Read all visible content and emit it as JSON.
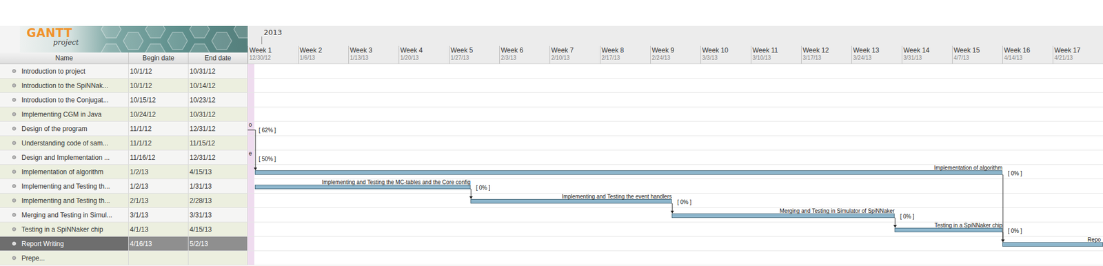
{
  "logo": {
    "title": "GANTT",
    "subtitle": "project"
  },
  "table": {
    "columns": [
      "Name",
      "Begin date",
      "End date"
    ]
  },
  "timeline": {
    "year": "2013",
    "weeks": [
      {
        "label": "Week 1",
        "date": "12/30/12"
      },
      {
        "label": "Week 2",
        "date": "1/6/13"
      },
      {
        "label": "Week 3",
        "date": "1/13/13"
      },
      {
        "label": "Week 4",
        "date": "1/20/13"
      },
      {
        "label": "Week 5",
        "date": "1/27/13"
      },
      {
        "label": "Week 6",
        "date": "2/3/13"
      },
      {
        "label": "Week 7",
        "date": "2/10/13"
      },
      {
        "label": "Week 8",
        "date": "2/17/13"
      },
      {
        "label": "Week 9",
        "date": "2/24/13"
      },
      {
        "label": "Week 10",
        "date": "3/3/13"
      },
      {
        "label": "Week 11",
        "date": "3/10/13"
      },
      {
        "label": "Week 12",
        "date": "3/17/13"
      },
      {
        "label": "Week 13",
        "date": "3/24/13"
      },
      {
        "label": "Week 14",
        "date": "3/31/13"
      },
      {
        "label": "Week 15",
        "date": "4/7/13"
      },
      {
        "label": "Week 16",
        "date": "4/14/13"
      },
      {
        "label": "Week 17",
        "date": "4/21/13"
      }
    ]
  },
  "tasks": [
    {
      "name": "Introduction to project",
      "begin": "10/1/12",
      "end": "10/31/12",
      "selected": false
    },
    {
      "name": "Introduction to the SpiNNak...",
      "begin": "10/1/12",
      "end": "10/14/12",
      "selected": false
    },
    {
      "name": "Introduction to the Conjugat...",
      "begin": "10/15/12",
      "end": "10/23/12",
      "selected": false
    },
    {
      "name": "Implementing CGM in Java",
      "begin": "10/24/12",
      "end": "10/31/12",
      "selected": false
    },
    {
      "name": "Design of the program",
      "begin": "11/1/12",
      "end": "12/31/12",
      "selected": false,
      "bar_label": "o",
      "progress": "[ 62% ]"
    },
    {
      "name": "Understanding code of sam...",
      "begin": "11/1/12",
      "end": "11/15/12",
      "selected": false
    },
    {
      "name": "Design and Implementation ...",
      "begin": "11/16/12",
      "end": "12/31/12",
      "selected": false,
      "bar_label": "e",
      "progress": "[ 50% ]"
    },
    {
      "name": "Implementation of algorithm",
      "begin": "1/2/13",
      "end": "4/15/13",
      "selected": false,
      "bar_label": "Implementation of algorithm",
      "progress": "[ 0% ]"
    },
    {
      "name": "Implementing and Testing th...",
      "begin": "1/2/13",
      "end": "1/31/13",
      "selected": false,
      "bar_label": "Implementing and Testing the MC-tables and the Core config",
      "progress": "[ 0% ]"
    },
    {
      "name": "Implementing and Testing th...",
      "begin": "2/1/13",
      "end": "2/28/13",
      "selected": false,
      "bar_label": "Implementing and Testing the event handlers",
      "progress": "[ 0% ]"
    },
    {
      "name": "Merging and Testing in Simul...",
      "begin": "3/1/13",
      "end": "3/31/13",
      "selected": false,
      "bar_label": "Merging and Testing in Simulator of SpiNNaker",
      "progress": "[ 0% ]"
    },
    {
      "name": "Testing in a SpiNNaker chip",
      "begin": "4/1/13",
      "end": "4/15/13",
      "selected": false,
      "bar_label": "Testing in a SpiNNaker chip",
      "progress": "[ 0% ]"
    },
    {
      "name": "Report Writing",
      "begin": "4/16/13",
      "end": "5/2/13",
      "selected": true,
      "bar_label": "Repo"
    },
    {
      "name": "Prepe...",
      "begin": "",
      "end": "",
      "selected": false
    }
  ],
  "links": [
    {
      "from": 4,
      "to": 7
    },
    {
      "from": 8,
      "to": 9
    },
    {
      "from": 9,
      "to": 10
    },
    {
      "from": 10,
      "to": 11
    },
    {
      "from": 11,
      "to": 12
    },
    {
      "from": 7,
      "to": 12
    }
  ]
}
